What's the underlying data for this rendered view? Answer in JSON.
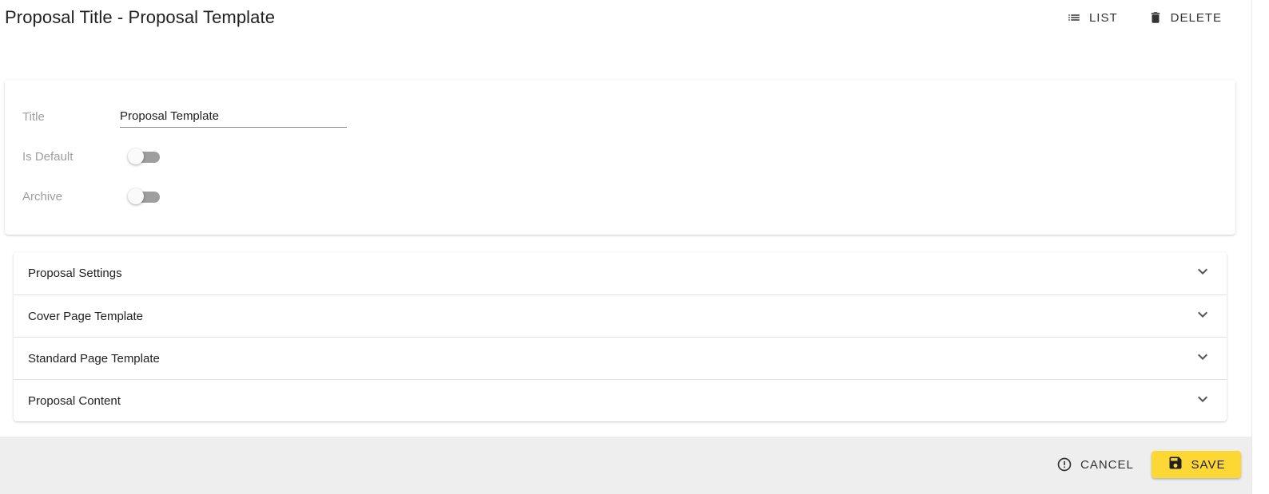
{
  "header": {
    "title": "Proposal Title - Proposal Template",
    "list_label": "LIST",
    "delete_label": "DELETE"
  },
  "form": {
    "title_label": "Title",
    "title_value": "Proposal Template",
    "is_default_label": "Is Default",
    "is_default": false,
    "archive_label": "Archive",
    "archive": false
  },
  "sections": [
    {
      "label": "Proposal Settings"
    },
    {
      "label": "Cover Page Template"
    },
    {
      "label": "Standard Page Template"
    },
    {
      "label": "Proposal Content"
    }
  ],
  "footer": {
    "cancel_label": "CANCEL",
    "save_label": "SAVE"
  },
  "icons": {
    "list": "list-icon",
    "delete": "trash-icon",
    "expand": "chevron-down-icon",
    "cancel": "alert-circle-icon",
    "save": "floppy-disk-icon"
  },
  "colors": {
    "save_button": "#fdd835",
    "footer_background": "#eeeeee",
    "toggle_off_track": "#9e9e9e"
  }
}
